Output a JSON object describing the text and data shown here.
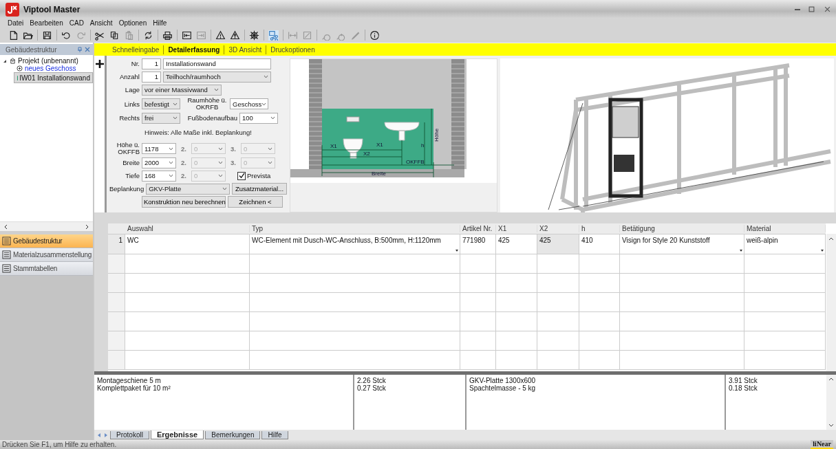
{
  "window": {
    "title": "Viptool Master"
  },
  "menu": [
    "Datei",
    "Bearbeiten",
    "CAD",
    "Ansicht",
    "Optionen",
    "Hilfe"
  ],
  "sidebar": {
    "title": "Gebäudestruktur",
    "tree": [
      {
        "label": "Projekt (unbenannt)",
        "kind": "project",
        "selected": false,
        "expanded": true,
        "children": [
          {
            "label": "neues Geschoss",
            "kind": "add",
            "selected": false
          },
          {
            "label": "IW01 Installationswand",
            "kind": "wall",
            "selected": true
          }
        ]
      }
    ],
    "nav": [
      {
        "label": "Gebäudestruktur",
        "selected": true
      },
      {
        "label": "Materialzusammenstellung",
        "selected": false
      },
      {
        "label": "Stammtabellen",
        "selected": false
      }
    ]
  },
  "tabs": [
    {
      "label": "Schnelleingabe",
      "selected": false
    },
    {
      "label": "Detailerfassung",
      "selected": true
    },
    {
      "label": "3D Ansicht",
      "selected": false
    },
    {
      "label": "Druckoptionen",
      "selected": false
    }
  ],
  "form": {
    "nr": {
      "label": "Nr.",
      "value": "1"
    },
    "name": {
      "value": "Installationswand"
    },
    "anzahl": {
      "label": "Anzahl",
      "value": "1"
    },
    "hoehe_typ": {
      "value": "Teilhoch/raumhoch",
      "editable": false
    },
    "lage": {
      "label": "Lage",
      "value": "vor einer Massivwand",
      "editable": false
    },
    "links": {
      "label": "Links",
      "value": "befestigt",
      "editable": false
    },
    "raumhoehe": {
      "label": "Raumhöhe ü. OKRFB",
      "value": "Geschoss",
      "editable": true
    },
    "rechts": {
      "label": "Rechts",
      "value": "frei",
      "editable": false
    },
    "fussbodenaufbau": {
      "label": "Fußbodenaufbau",
      "value": "100",
      "editable": true
    },
    "hint": "Hinweis: Alle Maße inkl. Beplankung!",
    "dims": [
      {
        "label": "Höhe ü. OKFFB",
        "value": "1178",
        "extra": [
          {
            "label": "2.",
            "value": "0",
            "disabled": true
          },
          {
            "label": "3.",
            "value": "0",
            "disabled": true
          }
        ]
      },
      {
        "label": "Breite",
        "value": "2000",
        "extra": [
          {
            "label": "2.",
            "value": "0",
            "disabled": true
          },
          {
            "label": "3.",
            "value": "0",
            "disabled": true
          }
        ]
      },
      {
        "label": "Tiefe",
        "value": "168",
        "extra": [
          {
            "label": "2.",
            "value": "0",
            "disabled": true
          }
        ]
      }
    ],
    "prevista": {
      "label": "Prevista",
      "checked": true
    },
    "beplankung": {
      "label": "Beplankung",
      "value": "GKV-Platte",
      "editable": false
    },
    "zusatz_button": "Zusatzmaterial...",
    "buttons": [
      "Konstruktion neu berechnen",
      "Zeichnen <"
    ]
  },
  "drawing": {
    "labels": [
      "X1",
      "X1",
      "X2",
      "h",
      "Höhe",
      "OKFFB",
      "Breite"
    ]
  },
  "table": {
    "columns": [
      {
        "label": "Auswahl",
        "dropdown": false,
        "readonly": false
      },
      {
        "label": "Typ",
        "dropdown": true,
        "readonly": false
      },
      {
        "label": "Artikel Nr.",
        "dropdown": false,
        "readonly": false
      },
      {
        "label": "X1",
        "dropdown": false,
        "readonly": false
      },
      {
        "label": "X2",
        "dropdown": false,
        "readonly": true
      },
      {
        "label": "h",
        "dropdown": false,
        "readonly": false
      },
      {
        "label": "Betätigung",
        "dropdown": true,
        "readonly": false
      },
      {
        "label": "Material",
        "dropdown": true,
        "readonly": false
      }
    ],
    "rows": [
      {
        "number": "1",
        "cells": [
          "WC",
          "WC-Element mit Dusch-WC-Anschluss, B:500mm, H:1120mm",
          "771980",
          "425",
          "425",
          "410",
          "Visign for Style 20 Kunststoff",
          "weiß-alpin"
        ]
      }
    ]
  },
  "results": {
    "left": [
      {
        "item": "Montageschiene 5 m",
        "qty": "2.26 Stck"
      },
      {
        "item": "Komplettpaket für 10 m²",
        "qty": "0.27 Stck"
      }
    ],
    "right": [
      {
        "item": "GKV-Platte 1300x600",
        "qty": "3.91 Stck"
      },
      {
        "item": "Spachtelmasse - 5 kg",
        "qty": "0.18 Stck"
      }
    ]
  },
  "bottom_tabs": [
    {
      "label": "Protokoll",
      "selected": false
    },
    {
      "label": "Ergebnisse",
      "selected": true
    },
    {
      "label": "Bemerkungen",
      "selected": false
    },
    {
      "label": "Hilfe",
      "selected": false
    }
  ],
  "status_bar": {
    "text": "Drücken Sie F1, um Hilfe zu erhalten.",
    "brand": "liNear"
  }
}
